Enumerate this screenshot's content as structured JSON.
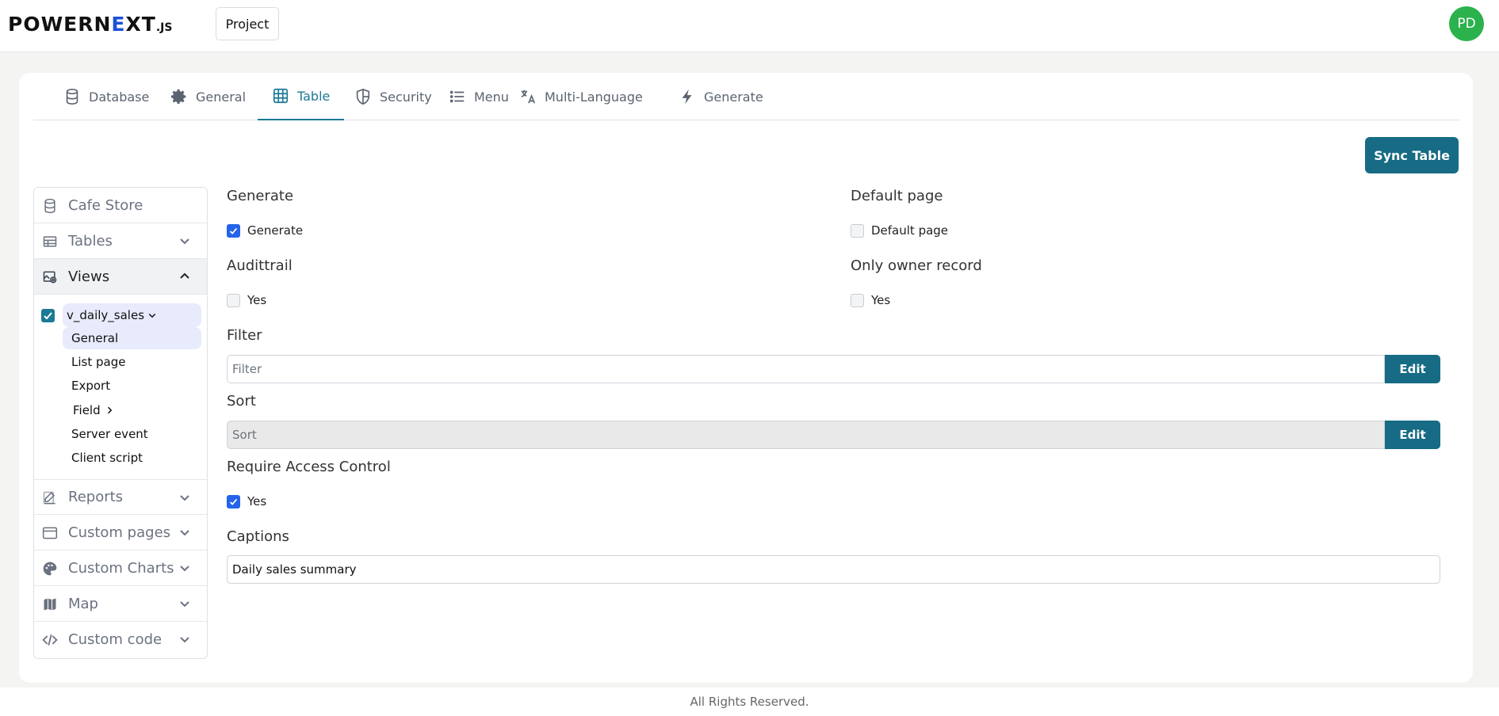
{
  "header": {
    "logo": {
      "part1": "POWERN",
      "accent": "E",
      "part2": "XT",
      "suffix": ".JS"
    },
    "project_label": "Project",
    "avatar_initials": "PD"
  },
  "tabs": [
    {
      "label": "Database",
      "icon": "database-icon",
      "active": false
    },
    {
      "label": "General",
      "icon": "gear-icon",
      "active": false
    },
    {
      "label": "Table",
      "icon": "table-icon",
      "active": true
    },
    {
      "label": "Security",
      "icon": "shield-icon",
      "active": false
    },
    {
      "label": "Menu",
      "icon": "list-icon",
      "active": false
    },
    {
      "label": "Multi-Language",
      "icon": "translate-icon",
      "active": false
    },
    {
      "label": "Generate",
      "icon": "bolt-icon",
      "active": false
    }
  ],
  "sync_button": "Sync Table",
  "sidebar": {
    "items": [
      {
        "label": "Cafe Store",
        "icon": "database-icon"
      },
      {
        "label": "Tables",
        "icon": "table-icon"
      },
      {
        "label": "Views",
        "icon": "view-icon"
      },
      {
        "label": "Reports",
        "icon": "edit-icon"
      },
      {
        "label": "Custom pages",
        "icon": "browser-icon"
      },
      {
        "label": "Custom Charts",
        "icon": "palette-icon"
      },
      {
        "label": "Map",
        "icon": "map-icon"
      },
      {
        "label": "Custom code",
        "icon": "code-icon"
      }
    ],
    "view_node": "v_daily_sales",
    "sub_items": [
      "General",
      "List page",
      "Export",
      "Field",
      "Server event",
      "Client script"
    ]
  },
  "form": {
    "generate": {
      "title": "Generate",
      "option": "Generate",
      "checked": true
    },
    "default_page": {
      "title": "Default page",
      "option": "Default page",
      "checked": false
    },
    "audittrail": {
      "title": "Audittrail",
      "option": "Yes",
      "checked": false
    },
    "only_owner": {
      "title": "Only owner record",
      "option": "Yes",
      "checked": false
    },
    "filter": {
      "title": "Filter",
      "placeholder": "Filter",
      "button": "Edit"
    },
    "sort": {
      "title": "Sort",
      "placeholder": "Sort",
      "button": "Edit"
    },
    "access_control": {
      "title": "Require Access Control",
      "option": "Yes",
      "checked": true
    },
    "captions": {
      "title": "Captions",
      "value": "Daily sales summary"
    }
  },
  "footer": "All Rights Reserved.",
  "colors": {
    "accent": "#176b84",
    "tab_active": "#1b7a95",
    "checkbox": "#2563eb",
    "avatar": "#2bb24c"
  }
}
